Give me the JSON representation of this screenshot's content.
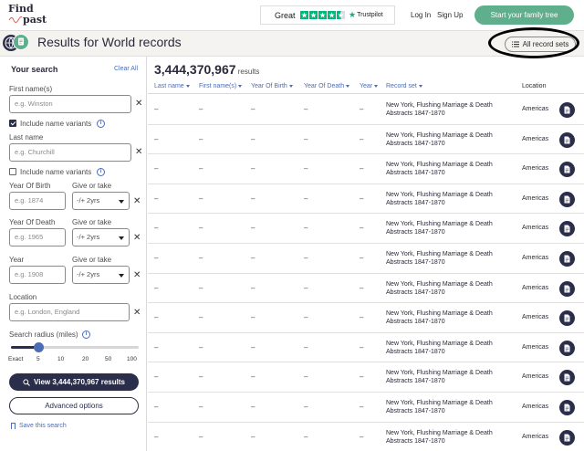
{
  "header": {
    "logo_line1": "Find",
    "logo_line2": "past",
    "trustpilot_great": "Great",
    "trustpilot_name": "Trustpilot",
    "login": "Log In",
    "signup": "Sign Up",
    "cta": "Start your family tree"
  },
  "results_bar": {
    "title": "Results for World records",
    "all_record_sets": "All record sets"
  },
  "search": {
    "title": "Your search",
    "clear_all": "Clear All",
    "first_name_label": "First name(s)",
    "first_name_placeholder": "e.g. Winston",
    "include_variants_1": "Include name variants",
    "last_name_label": "Last name",
    "last_name_placeholder": "e.g. Churchill",
    "include_variants_2": "Include name variants",
    "yob_label": "Year Of Birth",
    "yob_placeholder": "e.g. 1874",
    "give_or_take": "Give or take",
    "yod_label": "Year Of Death",
    "yod_placeholder": "e.g. 1965",
    "year_label": "Year",
    "year_placeholder": "e.g. 1908",
    "range_value": "-/+ 2yrs",
    "location_label": "Location",
    "location_placeholder": "e.g. London, England",
    "radius_label": "Search radius (miles)",
    "radius_ticks": [
      "Exact",
      "5",
      "10",
      "20",
      "50",
      "100"
    ],
    "radius_value_fraction": 0.22,
    "view_button": "View 3,444,370,967 results",
    "advanced": "Advanced options",
    "save_search": "Save this search"
  },
  "results": {
    "count": "3,444,370,967",
    "count_suffix": "results",
    "columns": [
      "Last name",
      "First name(s)",
      "Year Of Birth",
      "Year Of Death",
      "Year",
      "Record set",
      "Location"
    ],
    "rows": [
      {
        "last": "–",
        "first": "–",
        "yob": "–",
        "yod": "–",
        "year": "–",
        "record_set": "New York, Flushing Marriage & Death Abstracts 1847-1870",
        "location": "Americas"
      },
      {
        "last": "–",
        "first": "–",
        "yob": "–",
        "yod": "–",
        "year": "–",
        "record_set": "New York, Flushing Marriage & Death Abstracts 1847-1870",
        "location": "Americas"
      },
      {
        "last": "–",
        "first": "–",
        "yob": "–",
        "yod": "–",
        "year": "–",
        "record_set": "New York, Flushing Marriage & Death Abstracts 1847-1870",
        "location": "Americas"
      },
      {
        "last": "–",
        "first": "–",
        "yob": "–",
        "yod": "–",
        "year": "–",
        "record_set": "New York, Flushing Marriage & Death Abstracts 1847-1870",
        "location": "Americas"
      },
      {
        "last": "–",
        "first": "–",
        "yob": "–",
        "yod": "–",
        "year": "–",
        "record_set": "New York, Flushing Marriage & Death Abstracts 1847-1870",
        "location": "Americas"
      },
      {
        "last": "–",
        "first": "–",
        "yob": "–",
        "yod": "–",
        "year": "–",
        "record_set": "New York, Flushing Marriage & Death Abstracts 1847-1870",
        "location": "Americas"
      },
      {
        "last": "–",
        "first": "–",
        "yob": "–",
        "yod": "–",
        "year": "–",
        "record_set": "New York, Flushing Marriage & Death Abstracts 1847-1870",
        "location": "Americas"
      },
      {
        "last": "–",
        "first": "–",
        "yob": "–",
        "yod": "–",
        "year": "–",
        "record_set": "New York, Flushing Marriage & Death Abstracts 1847-1870",
        "location": "Americas"
      },
      {
        "last": "–",
        "first": "–",
        "yob": "–",
        "yod": "–",
        "year": "–",
        "record_set": "New York, Flushing Marriage & Death Abstracts 1847-1870",
        "location": "Americas"
      },
      {
        "last": "–",
        "first": "–",
        "yob": "–",
        "yod": "–",
        "year": "–",
        "record_set": "New York, Flushing Marriage & Death Abstracts 1847-1870",
        "location": "Americas"
      },
      {
        "last": "–",
        "first": "–",
        "yob": "–",
        "yod": "–",
        "year": "–",
        "record_set": "New York, Flushing Marriage & Death Abstracts 1847-1870",
        "location": "Americas"
      },
      {
        "last": "–",
        "first": "–",
        "yob": "–",
        "yod": "–",
        "year": "–",
        "record_set": "New York, Flushing Marriage & Death Abstracts 1847-1870",
        "location": "Americas"
      }
    ]
  },
  "colors": {
    "brand_green": "#5fae8c",
    "navy": "#2a2e4a",
    "link_blue": "#4b6cb7",
    "trustpilot_green": "#00b67a"
  },
  "icons": [
    "globe-icon",
    "document-icon",
    "list-icon",
    "info-icon",
    "close-icon",
    "chevron-down-icon",
    "bookmark-icon",
    "search-icon"
  ]
}
